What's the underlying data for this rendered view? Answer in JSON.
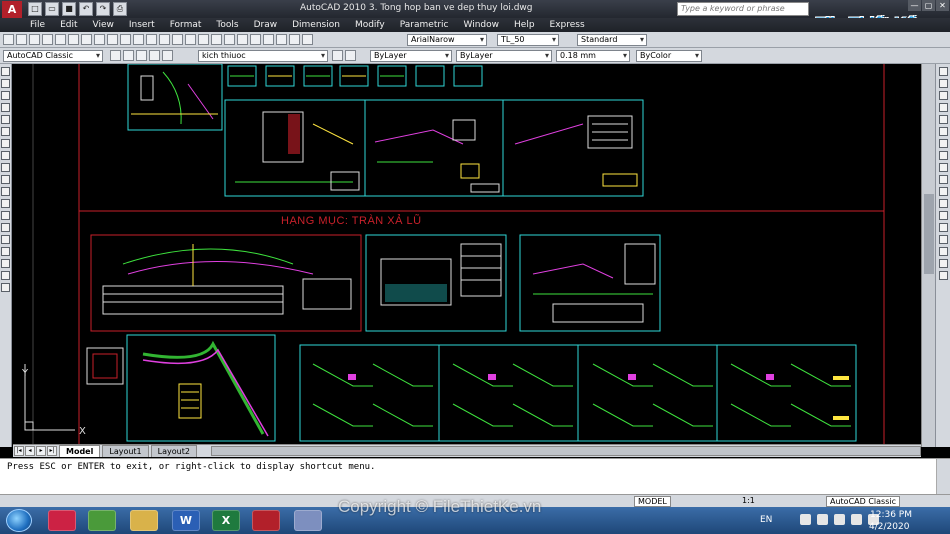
{
  "window": {
    "app_logo": "A",
    "title": "AutoCAD 2010     3. Tong hop ban ve dep thuy loi.dwg",
    "search_placeholder": "Type a keyword or phrase",
    "brand": "File Thiết Kế.vn",
    "controls": [
      "—",
      "▢",
      "✕"
    ]
  },
  "menu": [
    "File",
    "Edit",
    "View",
    "Insert",
    "Format",
    "Tools",
    "Draw",
    "Dimension",
    "Modify",
    "Parametric",
    "Window",
    "Help",
    "Express"
  ],
  "toolbar1": {
    "text_style_font": "ArialNarow",
    "dim_style": "TL_50",
    "table_style": "Standard"
  },
  "toolbar2": {
    "workspace": "AutoCAD Classic",
    "layer": "kich thiuoc",
    "color": "ByLayer",
    "linetype": "ByLayer",
    "lineweight": "0.18 mm",
    "plot_style": "ByColor"
  },
  "drawing": {
    "heading": "HẠNG MỤC: TRÀN XẢ LŨ",
    "ucs_x": "X",
    "ucs_y": "Y",
    "colors": {
      "frame_red": "#c8202a",
      "sheet_cyan": "#2fd8d8",
      "line_green": "#3ee23e",
      "line_yellow": "#ffe640",
      "line_magenta": "#e040e0"
    }
  },
  "tabs": [
    "Model",
    "Layout1",
    "Layout2"
  ],
  "active_tab": "Model",
  "command_line": "Press ESC or ENTER to exit, or right-click to display shortcut menu.",
  "status": {
    "model": "MODEL",
    "scale": "1:1",
    "workspace": "AutoCAD Classic"
  },
  "taskbar": {
    "apps": [
      "autocad-alt-icon",
      "browser-icon",
      "explorer-icon",
      "word-icon",
      "excel-icon",
      "autocad-icon",
      "paint-icon"
    ],
    "word_label": "W",
    "excel_label": "X",
    "lang": "EN",
    "time": "12:36 PM",
    "date": "4/2/2020"
  },
  "watermark": "Copyright © FileThietKe.vn"
}
